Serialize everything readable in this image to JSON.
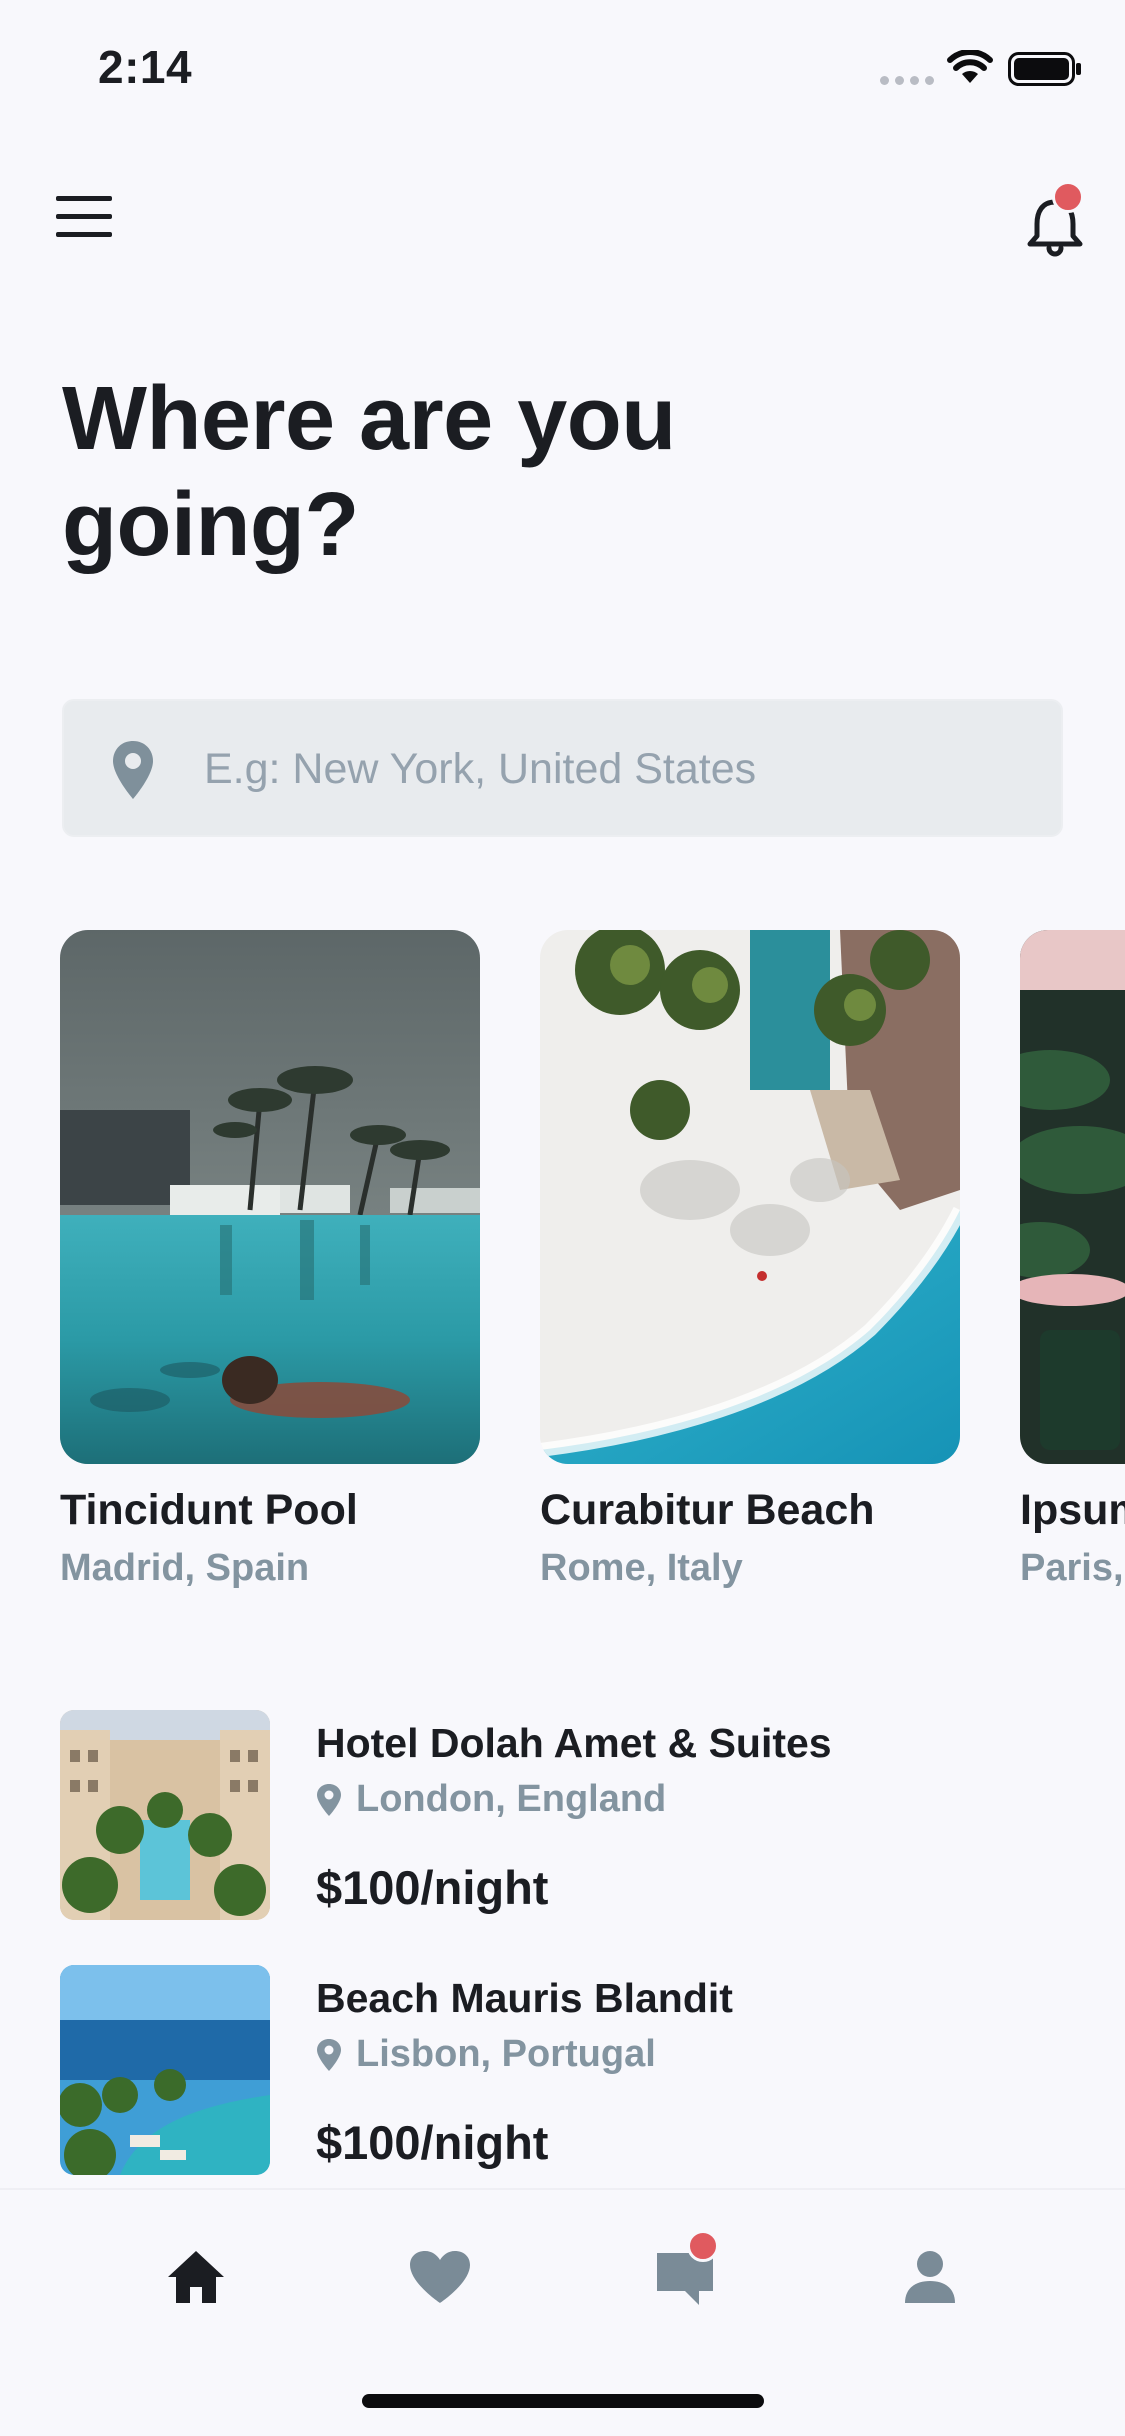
{
  "status_bar": {
    "time": "2:14"
  },
  "header": {
    "menu_icon": "hamburger-menu-icon",
    "notification_icon": "bell-icon",
    "has_unread_notifications": true
  },
  "page": {
    "title_line1": "Where are you",
    "title_line2": "going?"
  },
  "search": {
    "value": "",
    "placeholder": "E.g: New York, United States",
    "icon": "map-pin-icon"
  },
  "featured": [
    {
      "title": "Tincidunt Pool",
      "location": "Madrid, Spain"
    },
    {
      "title": "Curabitur Beach",
      "location": "Rome, Italy"
    },
    {
      "title": "Ipsum",
      "location": "Paris,"
    }
  ],
  "hotels": [
    {
      "name": "Hotel Dolah Amet & Suites",
      "location": "London, England",
      "price": "$100/night"
    },
    {
      "name": "Beach Mauris Blandit",
      "location": "Lisbon, Portugal",
      "price": "$100/night"
    }
  ],
  "bottom_nav": {
    "items": [
      {
        "icon": "home-icon",
        "active": true
      },
      {
        "icon": "heart-icon",
        "active": false
      },
      {
        "icon": "chat-icon",
        "active": false,
        "badge": true
      },
      {
        "icon": "user-icon",
        "active": false
      }
    ]
  },
  "colors": {
    "accent_dot": "#e05a5f",
    "muted_text": "#8394a0",
    "background": "#f8f8fc",
    "search_bg": "#e8ebee",
    "inactive_nav": "#7a8b97"
  }
}
